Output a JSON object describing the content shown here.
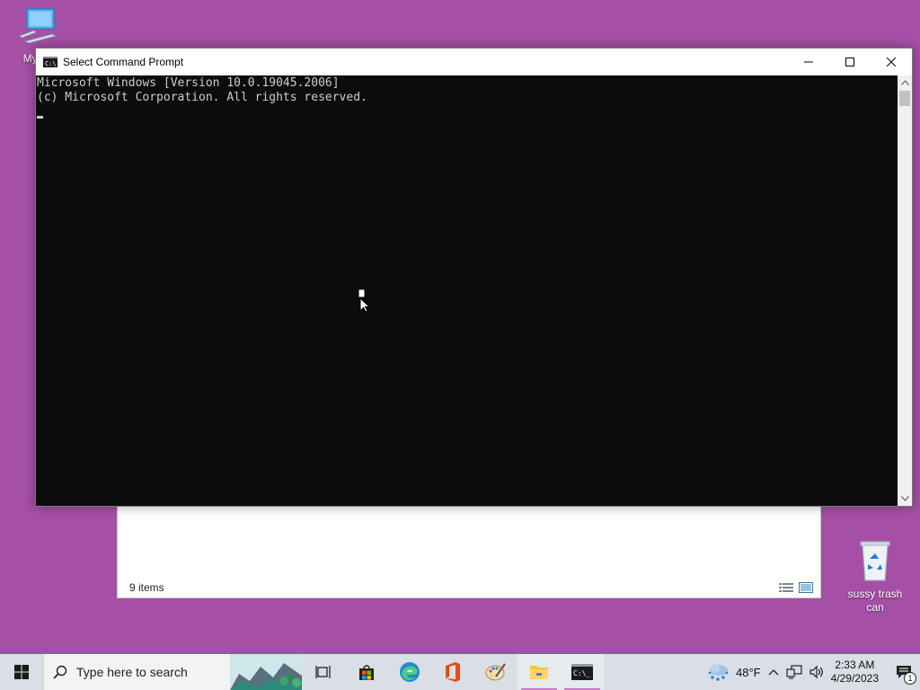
{
  "desktop": {
    "icons": [
      {
        "label": "My ba",
        "icon": "computer-icon"
      },
      {
        "label": "sussy trash can",
        "icon": "recycle-bin-icon"
      }
    ]
  },
  "explorer": {
    "status": "9 items"
  },
  "cmd": {
    "title": "Select Command Prompt",
    "lines": [
      "Microsoft Windows [Version 10.0.19045.2006]",
      "(c) Microsoft Corporation. All rights reserved."
    ],
    "bg_color": "#0c0c0c",
    "text_color": "#cccccc"
  },
  "taskbar": {
    "search_placeholder": "Type here to search",
    "weather": "48°F",
    "time": "2:33 AM",
    "date": "4/29/2023",
    "notification_count": "1",
    "pinned": [
      "task-view-icon",
      "store-icon",
      "edge-icon",
      "office-icon",
      "paint-icon",
      "file-explorer-icon",
      "command-prompt-icon"
    ]
  },
  "colors": {
    "desktop": "#a64fa6",
    "taskbar": "#d9dfe4",
    "accent": "#b066b0"
  }
}
